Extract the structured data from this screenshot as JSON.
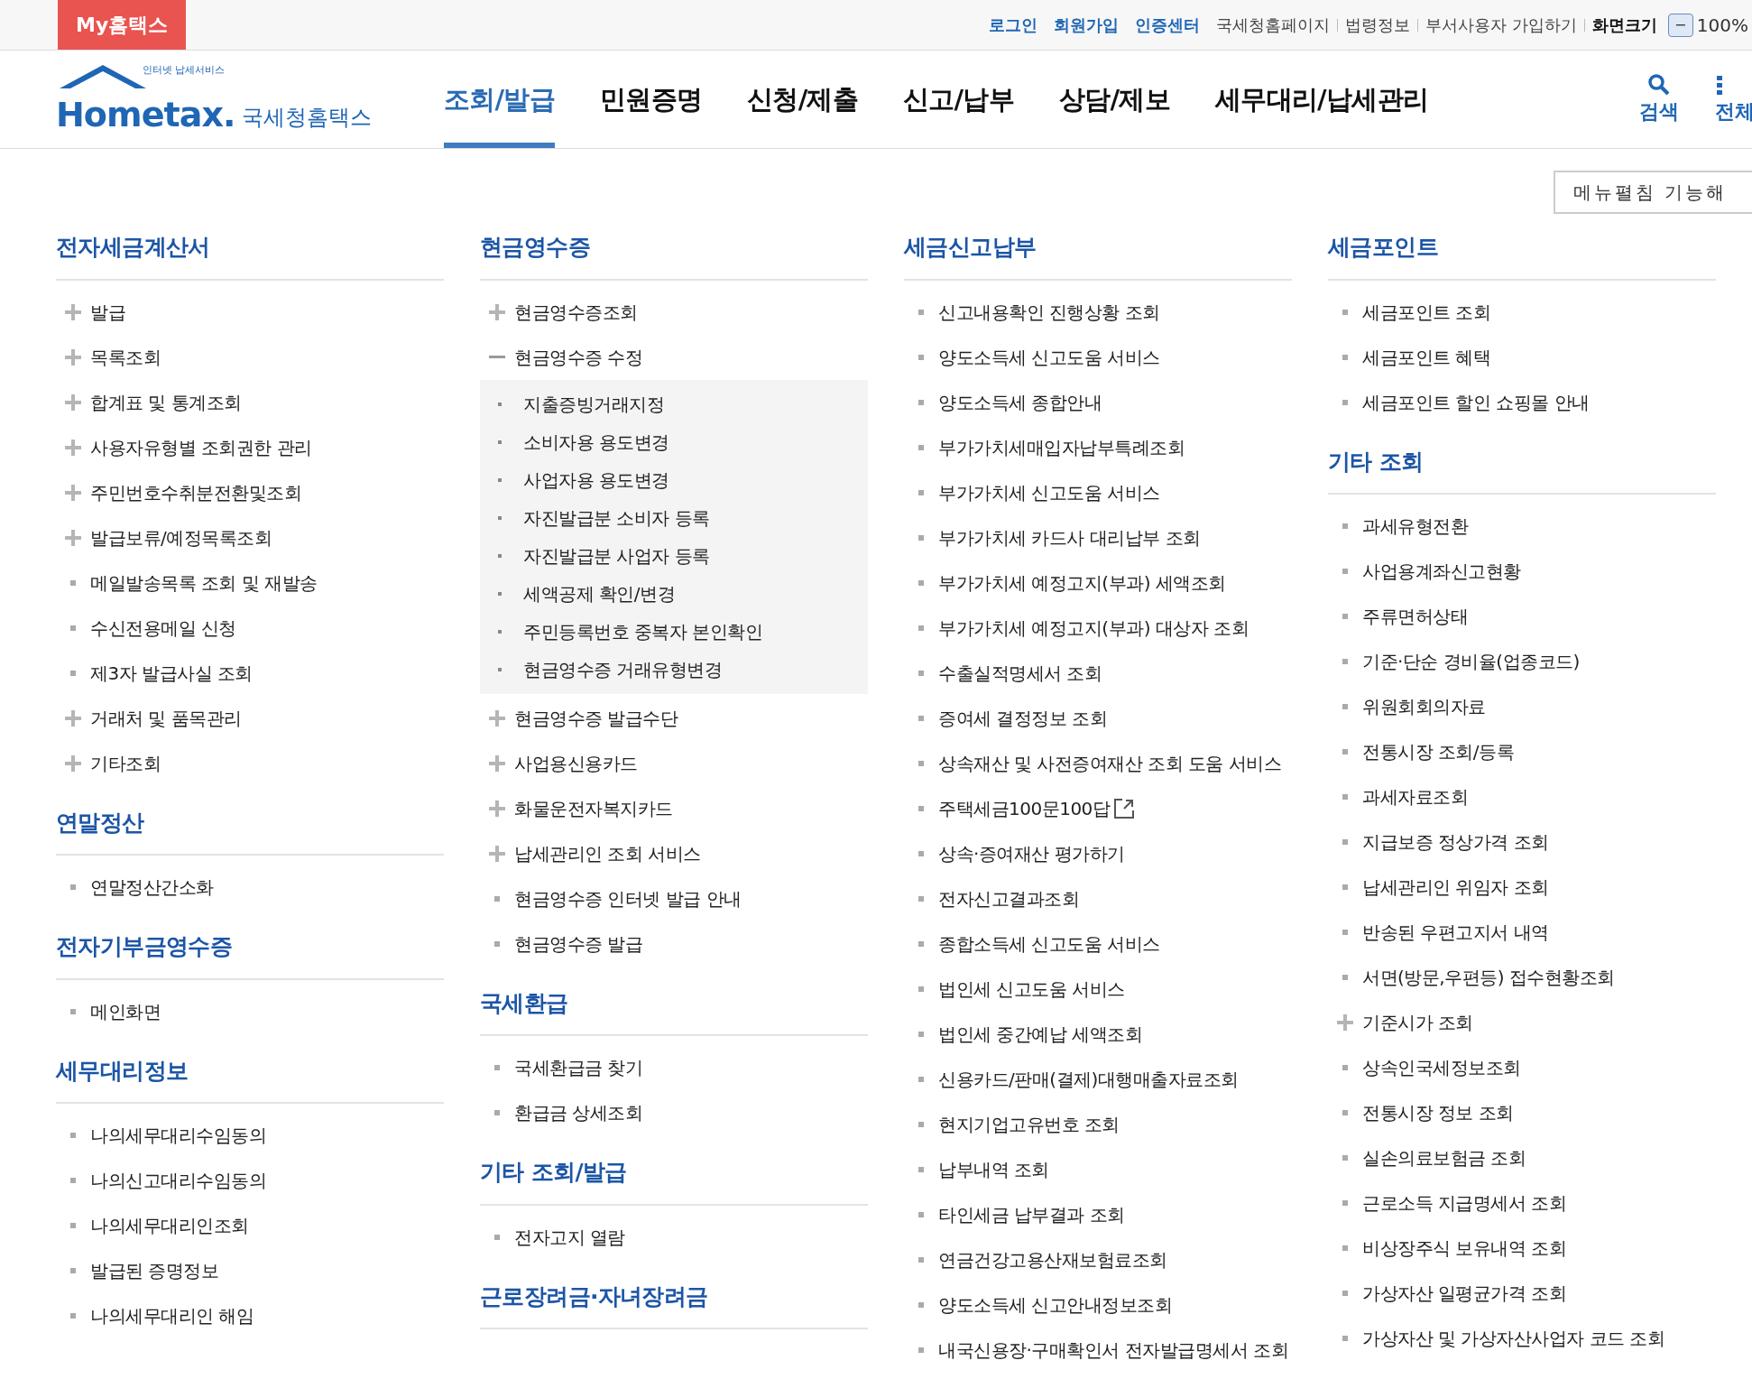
{
  "top_bar": {
    "my_tab": "My홈택스",
    "links": [
      {
        "label": "로그인",
        "kind": "primary"
      },
      {
        "label": "회원가입",
        "kind": "primary"
      },
      {
        "label": "인증센터",
        "kind": "primary"
      },
      {
        "label": "국세청홈페이지",
        "kind": "plain"
      },
      {
        "label": "법령정보",
        "kind": "plain"
      },
      {
        "label": "부서사용자 가입하기",
        "kind": "plain"
      },
      {
        "label": "화면크기",
        "kind": "strong"
      }
    ],
    "zoom": {
      "minus": "−",
      "value": "100%"
    }
  },
  "header": {
    "logo": {
      "tagline": "인터넷 납세서비스",
      "wordmark": "Hometax.",
      "name": "국세청홈택스"
    },
    "nav": [
      {
        "label": "조회/발급",
        "selected": true
      },
      {
        "label": "민원증명",
        "selected": false
      },
      {
        "label": "신청/제출",
        "selected": false
      },
      {
        "label": "신고/납부",
        "selected": false
      },
      {
        "label": "상담/제보",
        "selected": false
      },
      {
        "label": "세무대리/납세관리",
        "selected": false
      }
    ],
    "search": "검색",
    "all_menu": "전체"
  },
  "toggle_button": "메뉴펼침 기능해",
  "columns": [
    {
      "sections": [
        {
          "title": "전자세금계산서",
          "items": [
            {
              "label": "발급",
              "kind": "plus"
            },
            {
              "label": "목록조회",
              "kind": "plus"
            },
            {
              "label": "합계표 및 통계조회",
              "kind": "plus"
            },
            {
              "label": "사용자유형별 조회권한 관리",
              "kind": "plus"
            },
            {
              "label": "주민번호수취분전환및조회",
              "kind": "plus"
            },
            {
              "label": "발급보류/예정목록조회",
              "kind": "plus"
            },
            {
              "label": "메일발송목록 조회 및 재발송",
              "kind": "leaf"
            },
            {
              "label": "수신전용메일 신청",
              "kind": "leaf"
            },
            {
              "label": "제3자 발급사실 조회",
              "kind": "leaf"
            },
            {
              "label": "거래처 및 품목관리",
              "kind": "plus"
            },
            {
              "label": "기타조회",
              "kind": "plus"
            }
          ]
        },
        {
          "title": "연말정산",
          "items": [
            {
              "label": "연말정산간소화",
              "kind": "leaf"
            }
          ]
        },
        {
          "title": "전자기부금영수증",
          "items": [
            {
              "label": "메인화면",
              "kind": "leaf"
            }
          ]
        },
        {
          "title": "세무대리정보",
          "items": [
            {
              "label": "나의세무대리수임동의",
              "kind": "leaf"
            },
            {
              "label": "나의신고대리수임동의",
              "kind": "leaf"
            },
            {
              "label": "나의세무대리인조회",
              "kind": "leaf"
            },
            {
              "label": "발급된 증명정보",
              "kind": "leaf"
            },
            {
              "label": "나의세무대리인 해임",
              "kind": "leaf"
            }
          ]
        }
      ]
    },
    {
      "sections": [
        {
          "title": "현금영수증",
          "items": [
            {
              "label": "현금영수증조회",
              "kind": "plus"
            },
            {
              "label": "현금영수증 수정",
              "kind": "minus",
              "children": [
                {
                  "label": "지출증빙거래지정"
                },
                {
                  "label": "소비자용 용도변경"
                },
                {
                  "label": "사업자용 용도변경"
                },
                {
                  "label": "자진발급분 소비자 등록"
                },
                {
                  "label": "자진발급분 사업자 등록"
                },
                {
                  "label": "세액공제 확인/변경"
                },
                {
                  "label": "주민등록번호 중복자 본인확인"
                },
                {
                  "label": "현금영수증 거래유형변경"
                }
              ]
            },
            {
              "label": "현금영수증 발급수단",
              "kind": "plus"
            },
            {
              "label": "사업용신용카드",
              "kind": "plus"
            },
            {
              "label": "화물운전자복지카드",
              "kind": "plus"
            },
            {
              "label": "납세관리인 조회 서비스",
              "kind": "plus"
            },
            {
              "label": "현금영수증 인터넷 발급 안내",
              "kind": "leaf"
            },
            {
              "label": "현금영수증 발급",
              "kind": "leaf"
            }
          ]
        },
        {
          "title": "국세환급",
          "items": [
            {
              "label": "국세환급금 찾기",
              "kind": "leaf"
            },
            {
              "label": "환급금 상세조회",
              "kind": "leaf"
            }
          ]
        },
        {
          "title": "기타 조회/발급",
          "items": [
            {
              "label": "전자고지 열람",
              "kind": "leaf"
            }
          ]
        },
        {
          "title": "근로장려금·자녀장려금"
        }
      ]
    },
    {
      "sections": [
        {
          "title": "세금신고납부",
          "items": [
            {
              "label": "신고내용확인 진행상황 조회",
              "kind": "leaf"
            },
            {
              "label": "양도소득세 신고도움 서비스",
              "kind": "leaf"
            },
            {
              "label": "양도소득세 종합안내",
              "kind": "leaf"
            },
            {
              "label": "부가가치세매입자납부특례조회",
              "kind": "leaf"
            },
            {
              "label": "부가가치세 신고도움 서비스",
              "kind": "leaf"
            },
            {
              "label": "부가가치세 카드사 대리납부 조회",
              "kind": "leaf"
            },
            {
              "label": "부가가치세 예정고지(부과) 세액조회",
              "kind": "leaf"
            },
            {
              "label": "부가가치세 예정고지(부과) 대상자 조회",
              "kind": "leaf"
            },
            {
              "label": "수출실적명세서 조회",
              "kind": "leaf"
            },
            {
              "label": "증여세 결정정보 조회",
              "kind": "leaf"
            },
            {
              "label": "상속재산 및 사전증여재산 조회 도움 서비스",
              "kind": "leaf"
            },
            {
              "label": "주택세금100문100답",
              "kind": "external"
            },
            {
              "label": "상속·증여재산 평가하기",
              "kind": "leaf"
            },
            {
              "label": "전자신고결과조회",
              "kind": "leaf"
            },
            {
              "label": "종합소득세 신고도움 서비스",
              "kind": "leaf"
            },
            {
              "label": "법인세 신고도움 서비스",
              "kind": "leaf"
            },
            {
              "label": "법인세 중간예납 세액조회",
              "kind": "leaf"
            },
            {
              "label": "신용카드/판매(결제)대행매출자료조회",
              "kind": "leaf"
            },
            {
              "label": "현지기업고유번호 조회",
              "kind": "leaf"
            },
            {
              "label": "납부내역 조회",
              "kind": "leaf"
            },
            {
              "label": "타인세금 납부결과 조회",
              "kind": "leaf"
            },
            {
              "label": "연금건강고용산재보험료조회",
              "kind": "leaf"
            },
            {
              "label": "양도소득세 신고안내정보조회",
              "kind": "leaf"
            },
            {
              "label": "내국신용장·구매확인서 전자발급명세서 조회",
              "kind": "leaf"
            }
          ]
        }
      ]
    },
    {
      "sections": [
        {
          "title": "세금포인트",
          "items": [
            {
              "label": "세금포인트 조회",
              "kind": "leaf"
            },
            {
              "label": "세금포인트 혜택",
              "kind": "leaf"
            },
            {
              "label": "세금포인트 할인 쇼핑몰 안내",
              "kind": "leaf"
            }
          ]
        },
        {
          "title": "기타 조회",
          "items": [
            {
              "label": "과세유형전환",
              "kind": "leaf"
            },
            {
              "label": "사업용계좌신고현황",
              "kind": "leaf"
            },
            {
              "label": "주류면허상태",
              "kind": "leaf"
            },
            {
              "label": "기준·단순 경비율(업종코드)",
              "kind": "leaf"
            },
            {
              "label": "위원회회의자료",
              "kind": "leaf"
            },
            {
              "label": "전통시장 조회/등록",
              "kind": "leaf"
            },
            {
              "label": "과세자료조회",
              "kind": "leaf"
            },
            {
              "label": "지급보증 정상가격 조회",
              "kind": "leaf"
            },
            {
              "label": "납세관리인 위임자 조회",
              "kind": "leaf"
            },
            {
              "label": "반송된 우편고지서 내역",
              "kind": "leaf"
            },
            {
              "label": "서면(방문,우편등) 접수현황조회",
              "kind": "leaf"
            },
            {
              "label": "기준시가 조회",
              "kind": "plus"
            },
            {
              "label": "상속인국세정보조회",
              "kind": "leaf"
            },
            {
              "label": "전통시장 정보 조회",
              "kind": "leaf"
            },
            {
              "label": "실손의료보험금 조회",
              "kind": "leaf"
            },
            {
              "label": "근로소득 지급명세서 조회",
              "kind": "leaf"
            },
            {
              "label": "비상장주식 보유내역 조회",
              "kind": "leaf"
            },
            {
              "label": "가상자산 일평균가격 조회",
              "kind": "leaf"
            },
            {
              "label": "가상자산 및 가상자산사업자 코드 조회",
              "kind": "leaf"
            }
          ]
        }
      ]
    }
  ]
}
